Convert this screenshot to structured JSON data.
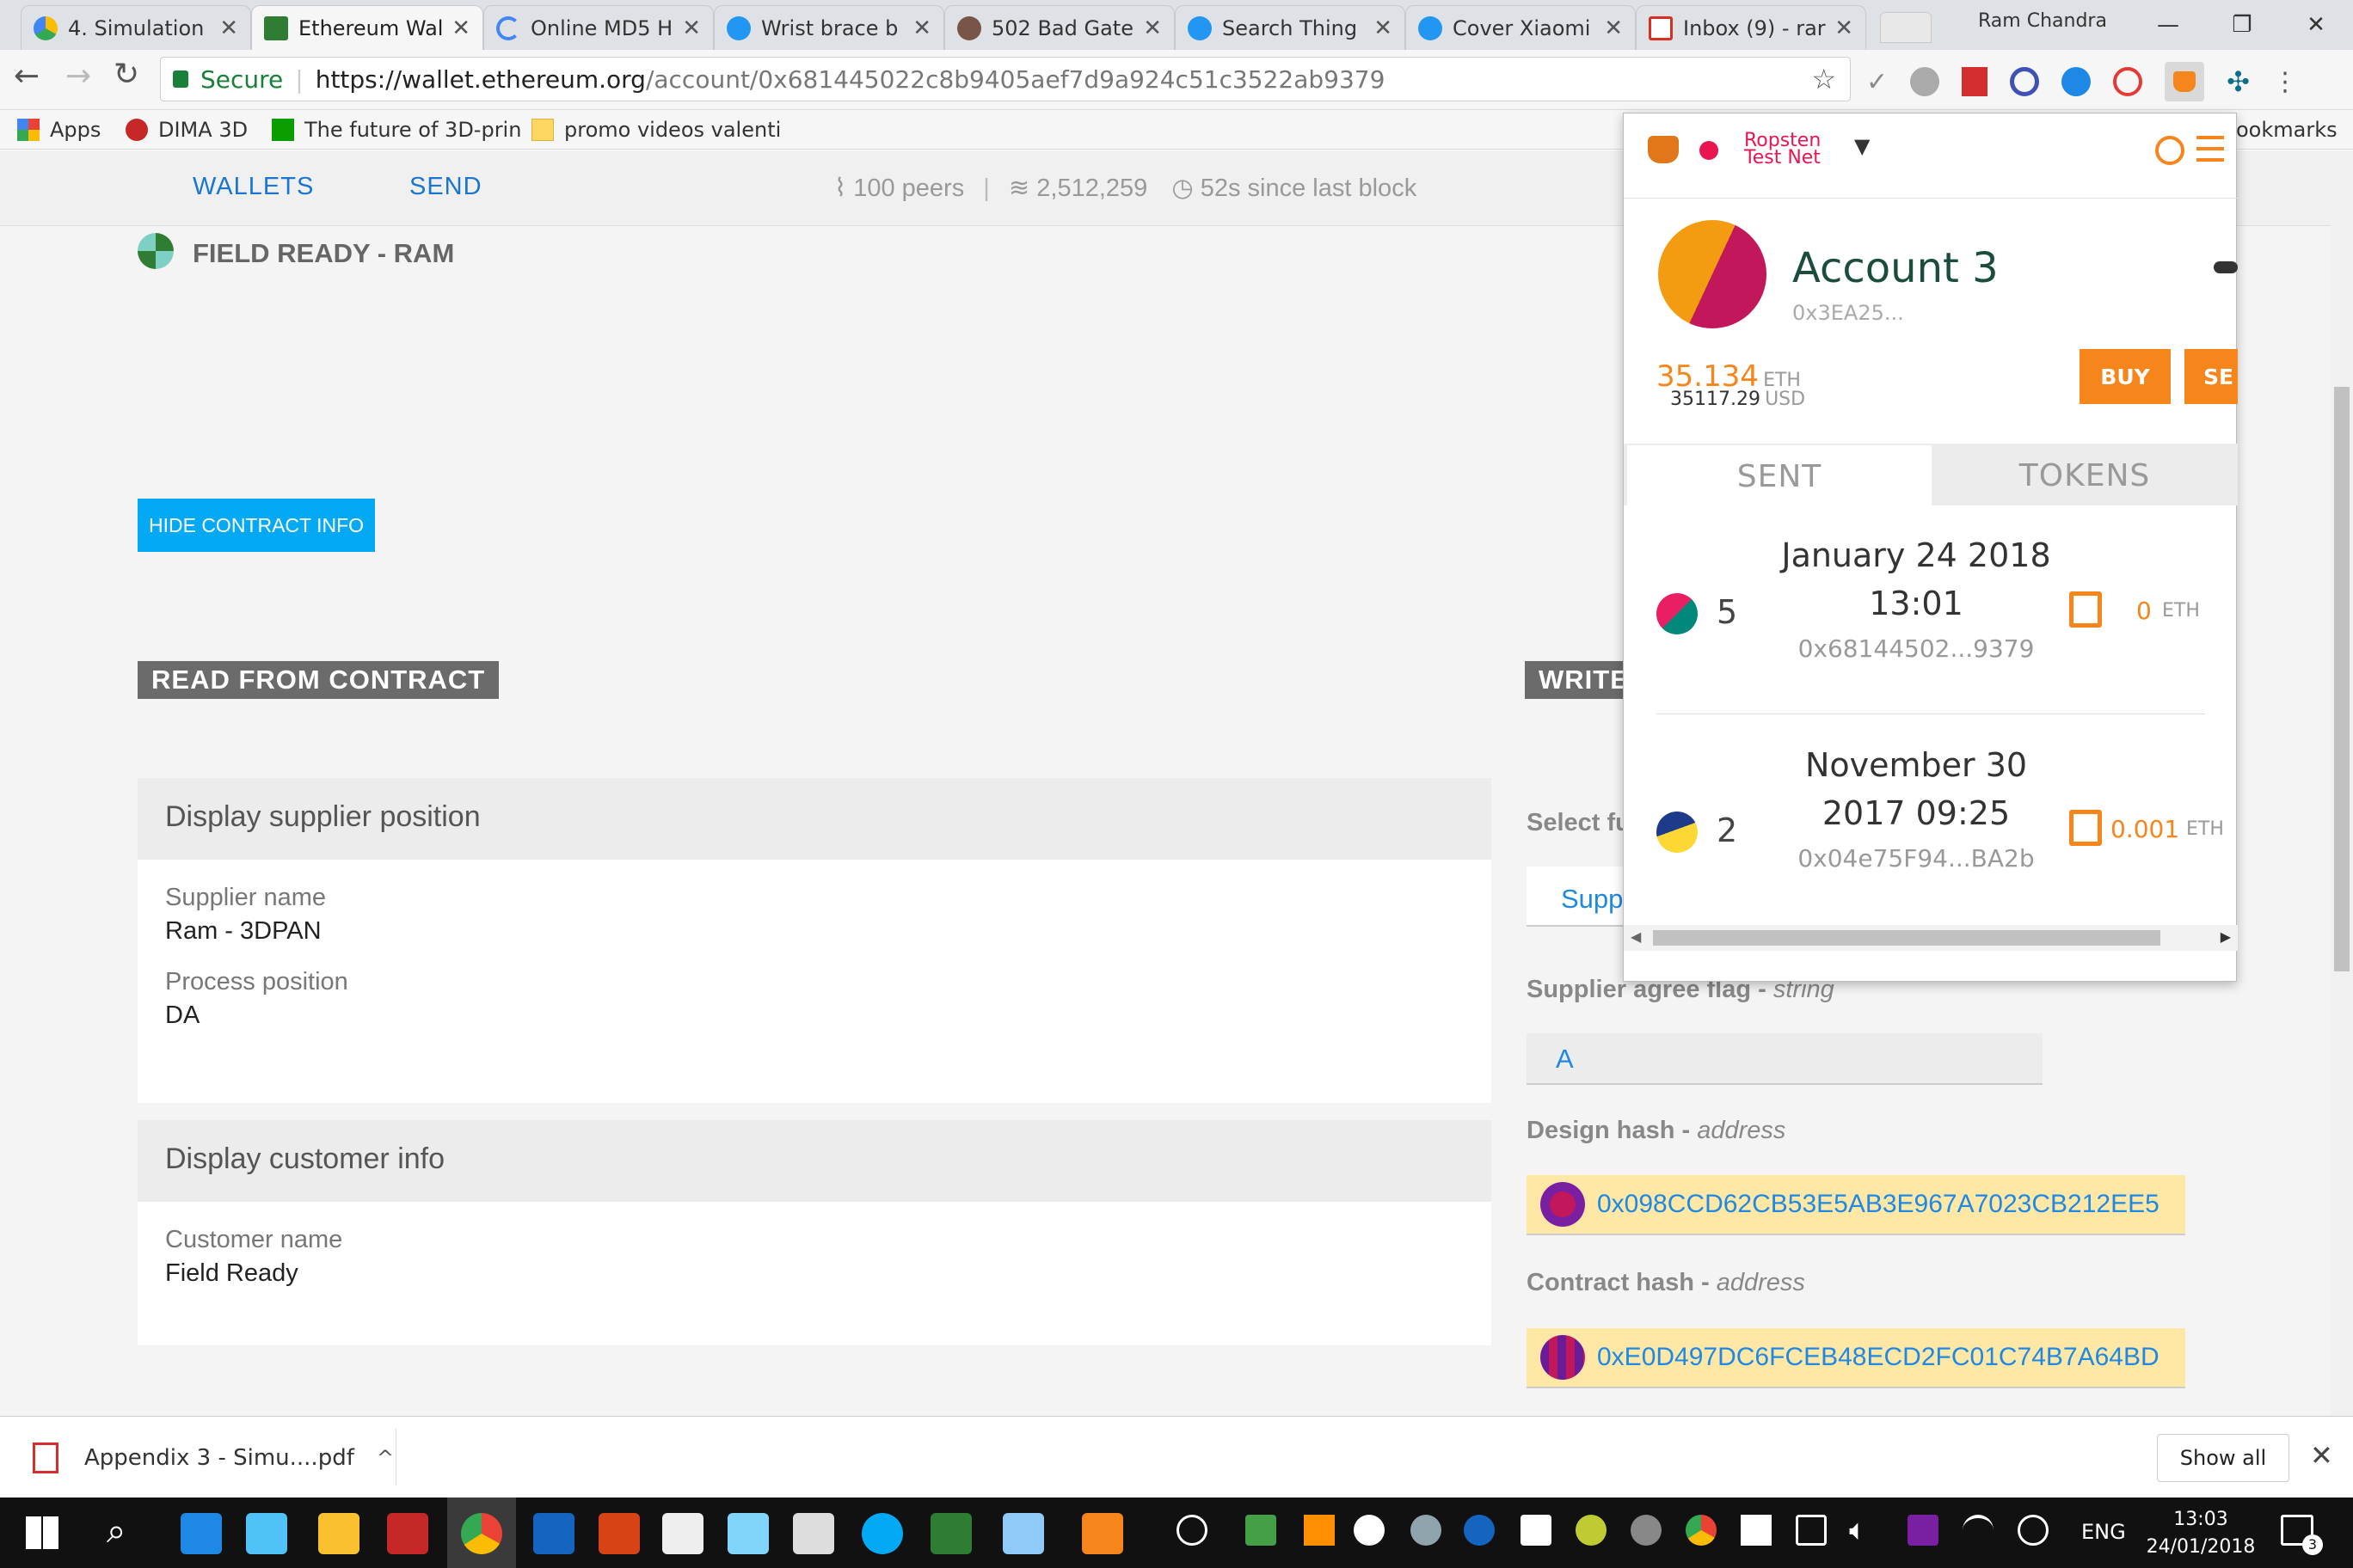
{
  "tabs": [
    {
      "label": "4. Simulation",
      "color": "#1a9c5b",
      "active": false
    },
    {
      "label": "Ethereum Wal",
      "color": "#2e7d32",
      "active": true
    },
    {
      "label": "Online MD5 H",
      "color": "#4285f4",
      "active": false
    },
    {
      "label": "Wrist brace b",
      "color": "#2196f3",
      "active": false
    },
    {
      "label": "502 Bad Gate",
      "color": "#795548",
      "active": false
    },
    {
      "label": "Search Thing",
      "color": "#2196f3",
      "active": false
    },
    {
      "label": "Cover Xiaomi",
      "color": "#2196f3",
      "active": false
    },
    {
      "label": "Inbox (9) - rar",
      "color": "#d93025",
      "active": false
    }
  ],
  "user_name": "Ram Chandra",
  "address_bar": {
    "secure_label": "Secure",
    "url_host": "https://wallet.ethereum.org",
    "url_path": "/account/0x681445022c8b9405aef7d9a924c51c3522ab9379"
  },
  "bookmarks": [
    {
      "label": "Apps"
    },
    {
      "label": "DIMA 3D"
    },
    {
      "label": "The future of 3D-prin"
    },
    {
      "label": "promo videos valenti"
    }
  ],
  "bookmarks_overflow": "ookmarks",
  "wallet_nav": {
    "wallets": "WALLETS",
    "send": "SEND",
    "peers": "100 peers",
    "block": "2,512,259",
    "since": "52s since last block"
  },
  "contract": {
    "name": "FIELD READY - RAM",
    "hide_button": "HIDE CONTRACT INFO",
    "read_heading": "READ FROM CONTRACT",
    "write_heading": "WRITE",
    "panels": [
      {
        "title": "Display supplier position",
        "fields": [
          {
            "label": "Supplier name",
            "value": "Ram - 3DPAN"
          },
          {
            "label": "Process position",
            "value": "DA"
          }
        ]
      },
      {
        "title": "Display customer info",
        "fields": [
          {
            "label": "Customer name",
            "value": "Field Ready"
          }
        ]
      }
    ],
    "write": {
      "select_label": "Select fu",
      "select_value": "Supp",
      "flag_label": "Supplier agree flag",
      "flag_type": "string",
      "flag_value": "A",
      "design_label": "Design hash",
      "design_type": "address",
      "design_value": "0x098CCD62CB53E5AB3E967A7023CB212EE5",
      "contract_label": "Contract hash",
      "contract_type": "address",
      "contract_value": "0xE0D497DC6FCEB48ECD2FC01C74B7A64BD"
    }
  },
  "metamask": {
    "network_line1": "Ropsten",
    "network_line2": "Test Net",
    "account_name": "Account 3",
    "account_address": "0x3EA25...",
    "balance_eth": "35.134",
    "eth_unit": "ETH",
    "balance_usd": "35117.29",
    "usd_unit": "USD",
    "buy_label": "BUY",
    "send_label": "SE",
    "tab_sent": "SENT",
    "tab_tokens": "TOKENS",
    "transactions": [
      {
        "nonce": "5",
        "date": "January 24 2018",
        "time": "13:01",
        "to": "0x68144502...9379",
        "amount": "0",
        "unit": "ETH"
      },
      {
        "nonce": "2",
        "date": "November 30",
        "time": "2017 09:25",
        "to": "0x04e75F94...BA2b",
        "amount": "0.001",
        "unit": "ETH"
      }
    ]
  },
  "download": {
    "file": "Appendix 3 - Simu....pdf",
    "show_all": "Show all"
  },
  "taskbar": {
    "lang": "ENG",
    "time": "13:03",
    "date": "24/01/2018",
    "notif_count": "3"
  }
}
